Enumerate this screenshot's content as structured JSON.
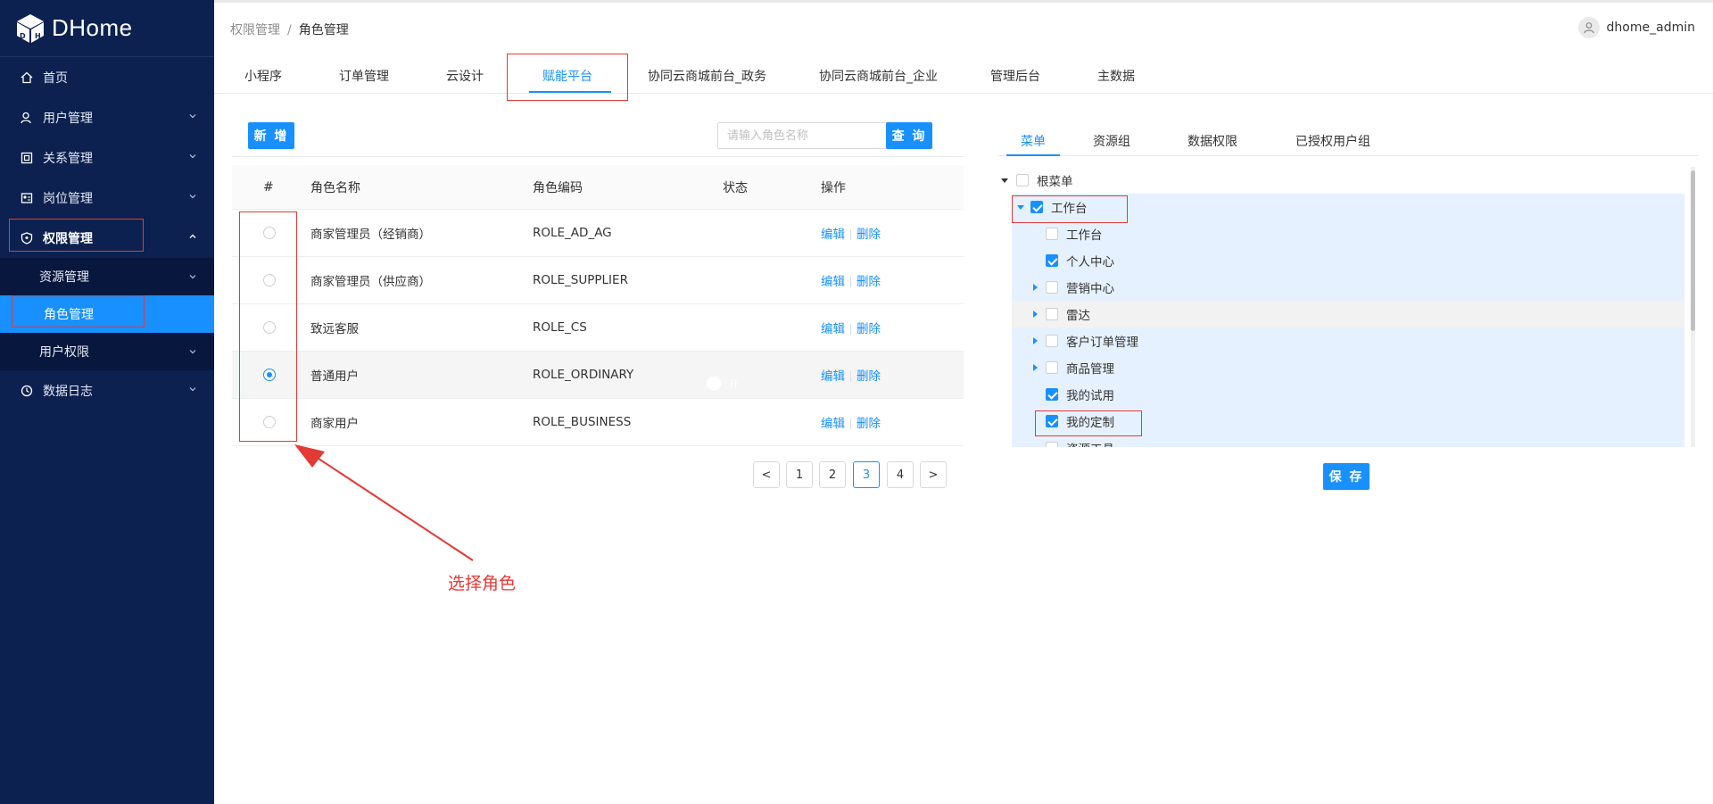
{
  "app": {
    "name": "DHome"
  },
  "sidebar": {
    "items": [
      {
        "label": "首页",
        "icon": "home-icon"
      },
      {
        "label": "用户管理",
        "icon": "user-icon"
      },
      {
        "label": "关系管理",
        "icon": "relation-icon"
      },
      {
        "label": "岗位管理",
        "icon": "position-icon"
      },
      {
        "label": "权限管理",
        "icon": "shield-icon"
      },
      {
        "label": "数据日志",
        "icon": "log-icon"
      }
    ],
    "submenu": [
      {
        "label": "资源管理"
      },
      {
        "label": "角色管理"
      },
      {
        "label": "用户权限"
      }
    ]
  },
  "breadcrumb": {
    "parent": "权限管理",
    "separator": "/",
    "current": "角色管理"
  },
  "user": {
    "name": "dhome_admin"
  },
  "top_tabs": [
    "小程序",
    "订单管理",
    "云设计",
    "赋能平台",
    "协同云商城前台_政务",
    "协同云商城前台_企业",
    "管理后台",
    "主数据"
  ],
  "toolbar": {
    "add_label": "新 增",
    "search_placeholder": "请输入角色名称",
    "search_label": "查 询"
  },
  "table": {
    "headers": {
      "index": "#",
      "name": "角色名称",
      "code": "角色编码",
      "status": "状态",
      "ops": "操作"
    },
    "edit_label": "编辑",
    "delete_label": "删除",
    "switch_label": "开",
    "rows": [
      {
        "name": "商家管理员（经销商）",
        "code": "ROLE_AD_AG",
        "selected": false
      },
      {
        "name": "商家管理员（供应商）",
        "code": "ROLE_SUPPLIER",
        "selected": false
      },
      {
        "name": "致远客服",
        "code": "ROLE_CS",
        "selected": false
      },
      {
        "name": "普通用户",
        "code": "ROLE_ORDINARY",
        "selected": true
      },
      {
        "name": "商家用户",
        "code": "ROLE_BUSINESS",
        "selected": false
      }
    ]
  },
  "pagination": {
    "prev": "<",
    "pages": [
      "1",
      "2",
      "3",
      "4"
    ],
    "current": "3",
    "next": ">"
  },
  "annotation": {
    "text": "选择角色"
  },
  "right_tabs": [
    "菜单",
    "资源组",
    "数据权限",
    "已授权用户组"
  ],
  "tree": {
    "nodes": [
      {
        "label": "根菜单",
        "checked": false
      },
      {
        "label": "工作台",
        "checked": true
      },
      {
        "label": "工作台",
        "checked": false
      },
      {
        "label": "个人中心",
        "checked": true
      },
      {
        "label": "营销中心",
        "checked": false
      },
      {
        "label": "雷达",
        "checked": false
      },
      {
        "label": "客户订单管理",
        "checked": false
      },
      {
        "label": "商品管理",
        "checked": false
      },
      {
        "label": "我的试用",
        "checked": true
      },
      {
        "label": "我的定制",
        "checked": true
      },
      {
        "label": "资源工具",
        "checked": false
      }
    ]
  },
  "save_label": "保 存",
  "colors": {
    "sidebar": "#0d2150",
    "accent": "#1890ff",
    "annotation": "#e53935"
  }
}
